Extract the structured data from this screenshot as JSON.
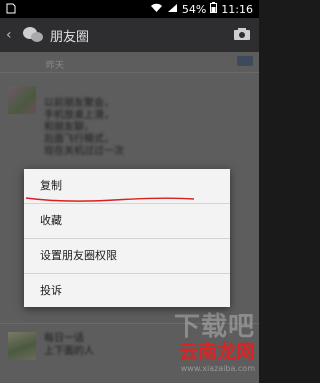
{
  "status_bar": {
    "battery": "54%",
    "time": "11:16"
  },
  "header": {
    "title": "朋友圈"
  },
  "feed": {
    "post1": {
      "time": "昨天",
      "text_lines": [
        "以前朋友聚会，",
        "手机放桌上滑，",
        "和朋友聊，",
        "后面飞行模式，",
        "现在关机过过一次"
      ]
    },
    "post2": {
      "text_lines": [
        "每日一话",
        "上下面的人"
      ]
    }
  },
  "context_menu": {
    "items": [
      "复制",
      "收藏",
      "设置朋友圈权限",
      "投诉"
    ],
    "accent": "#d9201f"
  },
  "watermark": {
    "top": "下载吧",
    "brand": "云南龙网",
    "url": "www.xiazaiba.com"
  }
}
